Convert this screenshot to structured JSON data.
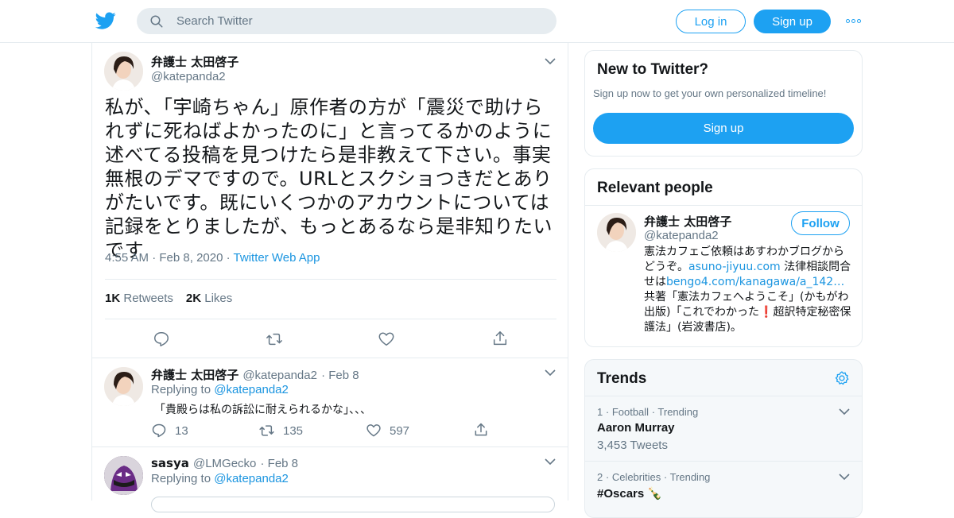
{
  "colors": {
    "accent": "#1da1f2",
    "link": "#1b95e0",
    "muted": "#657786",
    "heart_red": "#e0245e"
  },
  "header": {
    "search_placeholder": "Search Twitter",
    "login_label": "Log in",
    "signup_label": "Sign up"
  },
  "tweet": {
    "author_name": "弁護士 太田啓子",
    "author_handle": "@katepanda2",
    "text": "私が、「宇崎ちゃん」原作者の方が「震災で助けられずに死ねばよかったのに」と言ってるかのように述べてる投稿を見つけたら是非教えて下さい。事実無根のデマですので。URLとスクショつきだとありがたいです。既にいくつかのアカウントについては記録をとりましたが、もっとあるなら是非知りたいです",
    "time": "4:55 AM",
    "date": "Feb 8, 2020",
    "source": "Twitter Web App",
    "retweets_count": "1K",
    "retweets_label": "Retweets",
    "likes_count": "2K",
    "likes_label": "Likes"
  },
  "replies": [
    {
      "name": "弁護士 太田啓子",
      "handle": "@katepanda2",
      "date": "Feb 8",
      "replying_prefix": "Replying to",
      "replying_to": "@katepanda2",
      "text": "「貴殿らは私の訴訟に耐えられるかな」、、、",
      "reply_count": "13",
      "retweet_count": "135",
      "like_count": "597"
    },
    {
      "name": "sasya",
      "handle": "@LMGecko",
      "date": "Feb 8",
      "replying_prefix": "Replying to",
      "replying_to": "@katepanda2"
    }
  ],
  "new_to_twitter": {
    "title": "New to Twitter?",
    "subtitle": "Sign up now to get your own personalized timeline!",
    "signup_label": "Sign up"
  },
  "relevant_people": {
    "title": "Relevant people",
    "name": "弁護士 太田啓子",
    "handle": "@katepanda2",
    "follow_label": "Follow",
    "bio_1": "憲法カフェご依頼はあすわかブログからどうぞ。",
    "bio_link_1": "asuno-jiyuu.com",
    "bio_2": " 法律相談問合せは",
    "bio_link_2": "bengo4.com/kanagawa/a_142…",
    "bio_3": " 共著「憲法カフェへようこそ」(かもがわ出版)「これでわかった",
    "bio_emoji": "❗",
    "bio_4": "超訳特定秘密保護法」(岩波書店)。"
  },
  "trends": {
    "title": "Trends",
    "items": [
      {
        "rank": "1",
        "category": "Football",
        "status": "Trending",
        "name": "Aaron Murray",
        "count": "3,453 Tweets"
      },
      {
        "rank": "2",
        "category": "Celebrities",
        "status": "Trending",
        "name": "#Oscars",
        "emoji": "🍾"
      }
    ]
  }
}
